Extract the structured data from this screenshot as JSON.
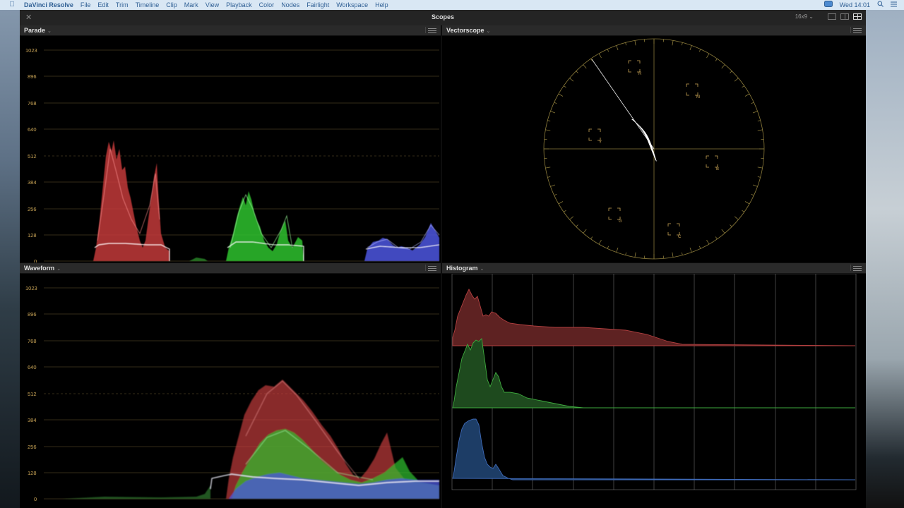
{
  "menubar": {
    "app_name": "DaVinci Resolve",
    "items": [
      "File",
      "Edit",
      "Trim",
      "Timeline",
      "Clip",
      "Mark",
      "View",
      "Playback",
      "Color",
      "Nodes",
      "Fairlight",
      "Workspace",
      "Help"
    ],
    "clock": "Wed 14:01"
  },
  "window": {
    "title": "Scopes",
    "aspect": "16x9",
    "close_icon": "close-icon"
  },
  "panels": {
    "parade": {
      "title": "Parade"
    },
    "vectorscope": {
      "title": "Vectorscope"
    },
    "waveform": {
      "title": "Waveform"
    },
    "histogram": {
      "title": "Histogram"
    }
  },
  "scale": {
    "ticks": [
      "1023",
      "896",
      "768",
      "640",
      "512",
      "384",
      "256",
      "128",
      "0"
    ]
  },
  "vectorscope": {
    "targets": [
      "R",
      "M",
      "Y",
      "B",
      "G",
      "C"
    ]
  },
  "colors": {
    "red": "#ff5a5a",
    "green": "#55ee55",
    "blue": "#6f78ff",
    "axis": "#c9a456"
  }
}
